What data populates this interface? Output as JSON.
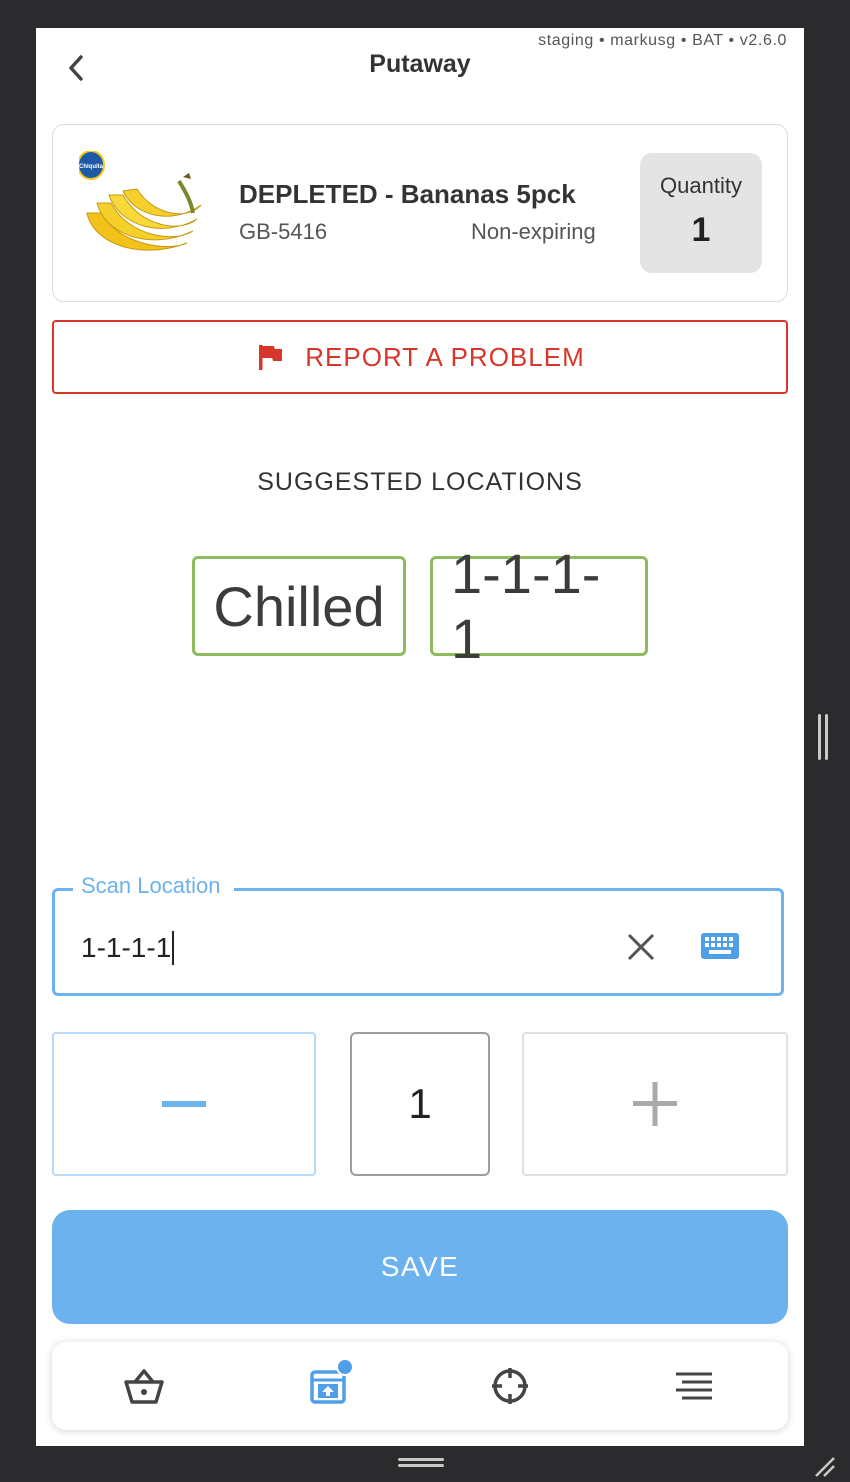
{
  "header": {
    "env_info": "staging • markusg • BAT • v2.6.0",
    "title": "Putaway",
    "back_icon": "chevron-left-icon"
  },
  "product": {
    "name": "DEPLETED - Bananas 5pck",
    "code": "GB-5416",
    "expiry": "Non-expiring",
    "quantity_label": "Quantity",
    "quantity_value": "1",
    "image_icon": "bananas-image",
    "logo_text": "Chiquita"
  },
  "report": {
    "label": "REPORT A PROBLEM",
    "icon": "flag-icon",
    "color": "#d9362b"
  },
  "suggested": {
    "title": "SUGGESTED LOCATIONS",
    "locations": [
      "Chilled",
      "1-1-1-1"
    ],
    "border_color": "#8dbb5d"
  },
  "scan": {
    "label": "Scan Location",
    "value": "1-1-1-1",
    "clear_icon": "close-icon",
    "keyboard_icon": "keyboard-icon",
    "accent": "#6cb2ee"
  },
  "stepper": {
    "value": "1",
    "minus_icon": "minus-icon",
    "plus_icon": "plus-icon"
  },
  "save": {
    "label": "SAVE",
    "color": "#6cb2ee"
  },
  "bottom_nav": {
    "items": [
      {
        "icon": "basket-icon",
        "active": false
      },
      {
        "icon": "putaway-icon",
        "active": true,
        "badge": true
      },
      {
        "icon": "crosshair-icon",
        "active": false
      },
      {
        "icon": "menu-icon",
        "active": false
      }
    ]
  }
}
